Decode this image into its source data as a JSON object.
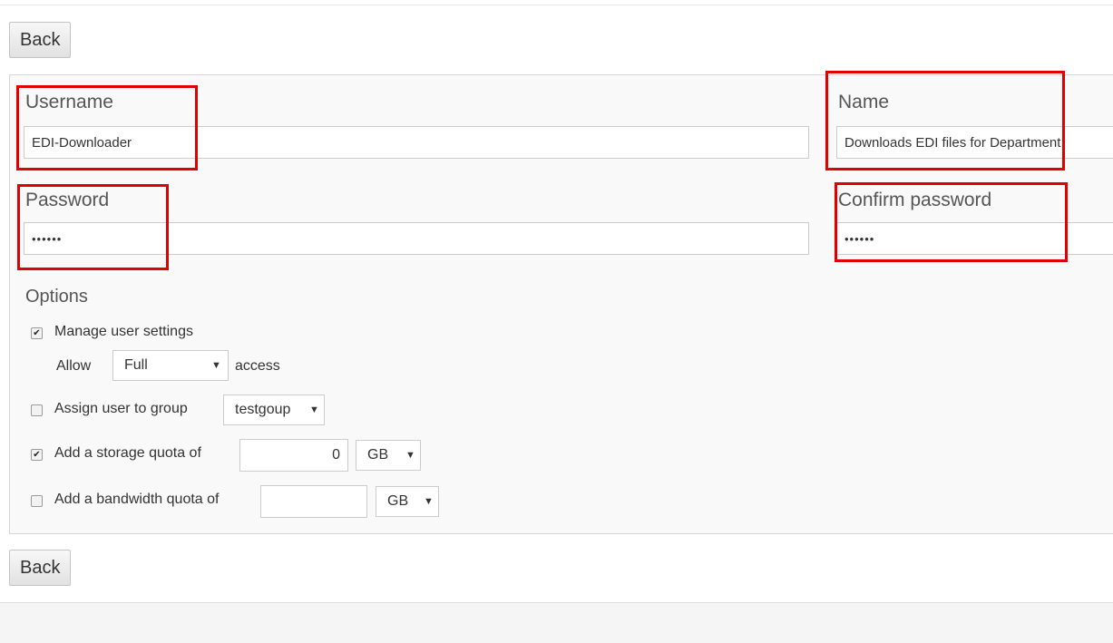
{
  "buttons": {
    "back_top": "Back",
    "back_bottom": "Back"
  },
  "form": {
    "username": {
      "label": "Username",
      "value": "EDI-Downloader"
    },
    "name": {
      "label": "Name",
      "value": "Downloads EDI files for Department"
    },
    "password": {
      "label": "Password",
      "value": "••••••"
    },
    "confirm_password": {
      "label": "Confirm password",
      "value": "••••••"
    }
  },
  "options": {
    "title": "Options",
    "manage_settings": {
      "checked": true,
      "label": "Manage user settings",
      "allow_prefix": "Allow",
      "access_level": "Full",
      "allow_suffix": "access"
    },
    "assign_group": {
      "checked": false,
      "label": "Assign user to group",
      "group": "testgoup"
    },
    "storage_quota": {
      "checked": true,
      "label": "Add a storage quota of",
      "value": "0",
      "unit": "GB"
    },
    "bandwidth_quota": {
      "checked": false,
      "label": "Add a bandwidth quota of",
      "value": "",
      "unit": "GB"
    }
  },
  "icons": {
    "checkmark": "✔",
    "dropdown_caret": "▼"
  },
  "colors": {
    "highlight": "#e00000",
    "panel_bg": "#f9f9f9",
    "page_bg": "#ffffff",
    "footer_bg": "#f5f5f5"
  }
}
